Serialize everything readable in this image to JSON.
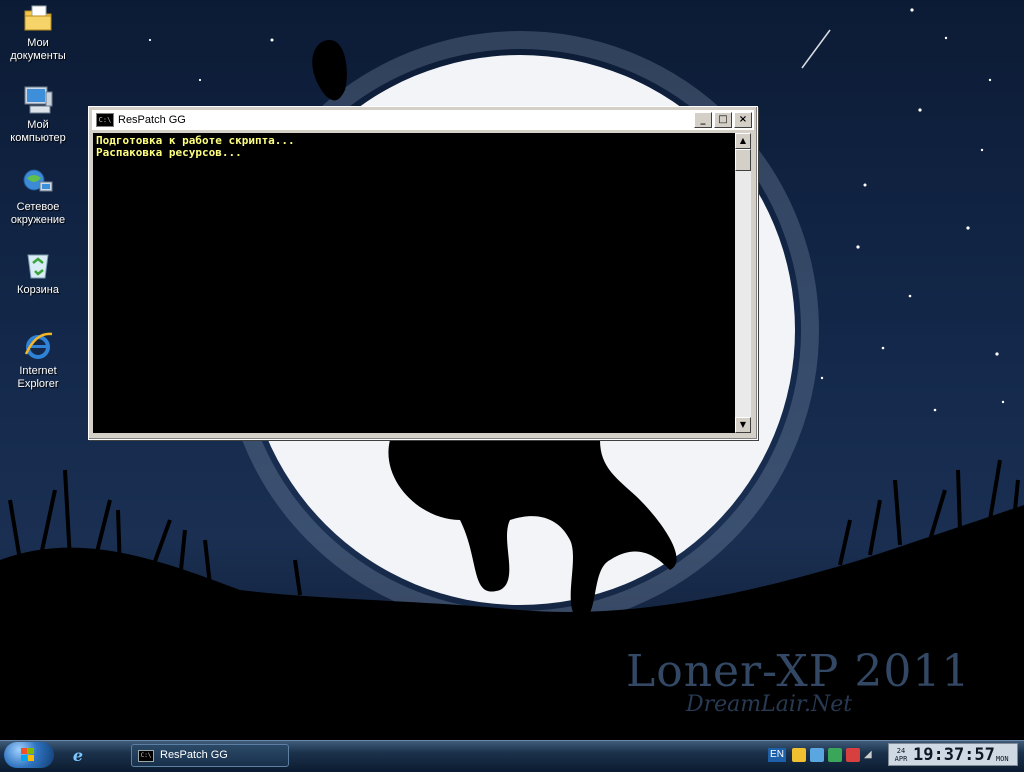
{
  "desktop": {
    "icons": [
      {
        "label_line1": "Мои",
        "label_line2": "документы",
        "icon": "my-documents-icon"
      },
      {
        "label_line1": "Мой",
        "label_line2": "компьютер",
        "icon": "my-computer-icon"
      },
      {
        "label_line1": "Сетевое",
        "label_line2": "окружение",
        "icon": "network-places-icon"
      },
      {
        "label_line1": "Корзина",
        "label_line2": "",
        "icon": "recycle-bin-icon"
      },
      {
        "label_line1": "Internet",
        "label_line2": "Explorer",
        "icon": "internet-explorer-icon"
      }
    ],
    "watermark_line1": "Loner-XP 2011",
    "watermark_line2": "DreamLair.Net"
  },
  "console": {
    "title": "ResPatch GG",
    "icon_text": "C:\\",
    "lines": [
      "Подготовка к работе скрипта...",
      "Распаковка ресурсов..."
    ],
    "text_color": "#ffff80",
    "background": "#000000",
    "minimize_symbol": "_",
    "maximize_symbol": "□",
    "close_symbol": "×"
  },
  "taskbar": {
    "quick_launch_icon": "internet-explorer-icon",
    "task_button_label": "ResPatch GG",
    "task_button_icon_text": "C:\\",
    "tray": {
      "language": "EN"
    },
    "clock": {
      "day": "24",
      "month": "APR",
      "time": "19:37:57",
      "weekday": "MON"
    }
  }
}
